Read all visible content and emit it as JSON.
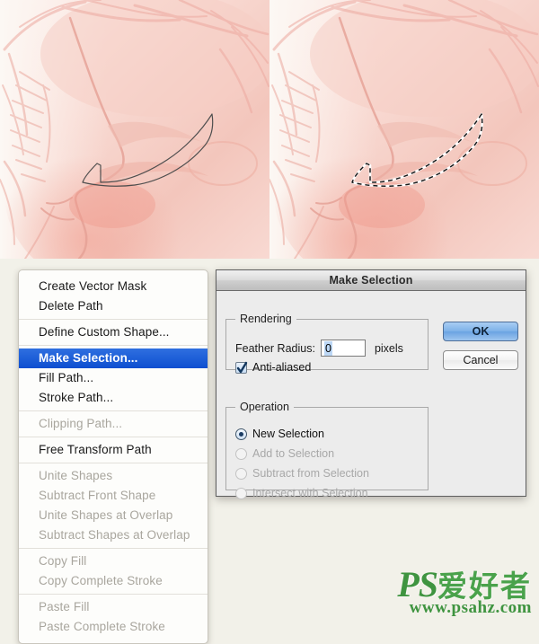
{
  "app": {
    "scene": "Photoshop path context menu with Make Selection dialog over an illustration"
  },
  "artwork": {
    "left_panel_name": "illustration-with-path",
    "right_panel_name": "illustration-with-selection",
    "background_color": "#f2f1e9",
    "skin_light": "#fbe7e2",
    "skin_mid": "#f6cfc7",
    "skin_shadow": "#eeb3a8",
    "sketch_line": "#e8a9a0",
    "path_stroke": "#4a4a4a"
  },
  "context_menu": {
    "name": "path-context-menu",
    "groups": [
      {
        "items": [
          {
            "label": "Create Vector Mask",
            "state": "enabled"
          },
          {
            "label": "Delete Path",
            "state": "enabled"
          }
        ]
      },
      {
        "items": [
          {
            "label": "Define Custom Shape...",
            "state": "enabled"
          }
        ]
      },
      {
        "items": [
          {
            "label": "Make Selection...",
            "state": "selected"
          },
          {
            "label": "Fill Path...",
            "state": "enabled"
          },
          {
            "label": "Stroke Path...",
            "state": "enabled"
          }
        ]
      },
      {
        "items": [
          {
            "label": "Clipping Path...",
            "state": "disabled"
          }
        ]
      },
      {
        "items": [
          {
            "label": "Free Transform Path",
            "state": "enabled"
          }
        ]
      },
      {
        "items": [
          {
            "label": "Unite Shapes",
            "state": "disabled"
          },
          {
            "label": "Subtract Front Shape",
            "state": "disabled"
          },
          {
            "label": "Unite Shapes at Overlap",
            "state": "disabled"
          },
          {
            "label": "Subtract Shapes at Overlap",
            "state": "disabled"
          }
        ]
      },
      {
        "items": [
          {
            "label": "Copy Fill",
            "state": "disabled"
          },
          {
            "label": "Copy Complete Stroke",
            "state": "disabled"
          }
        ]
      },
      {
        "items": [
          {
            "label": "Paste Fill",
            "state": "disabled"
          },
          {
            "label": "Paste Complete Stroke",
            "state": "disabled"
          }
        ]
      }
    ],
    "highlight_color": "#1158d8"
  },
  "dialog": {
    "title": "Make Selection",
    "rendering": {
      "legend": "Rendering",
      "feather_label": "Feather Radius:",
      "feather_value": "0",
      "feather_units": "pixels",
      "antialias_label": "Anti-aliased",
      "antialias_checked": true
    },
    "operation": {
      "legend": "Operation",
      "options": [
        {
          "label": "New Selection",
          "selected": true,
          "disabled": false
        },
        {
          "label": "Add to Selection",
          "selected": false,
          "disabled": true
        },
        {
          "label": "Subtract from Selection",
          "selected": false,
          "disabled": true
        },
        {
          "label": "Intersect with Selection",
          "selected": false,
          "disabled": true
        }
      ]
    },
    "buttons": {
      "ok": "OK",
      "cancel": "Cancel"
    }
  },
  "watermark": {
    "brand": "PS",
    "brand_cjk": "爱好者",
    "url": "www.psahz.com",
    "color": "#3f9440"
  }
}
